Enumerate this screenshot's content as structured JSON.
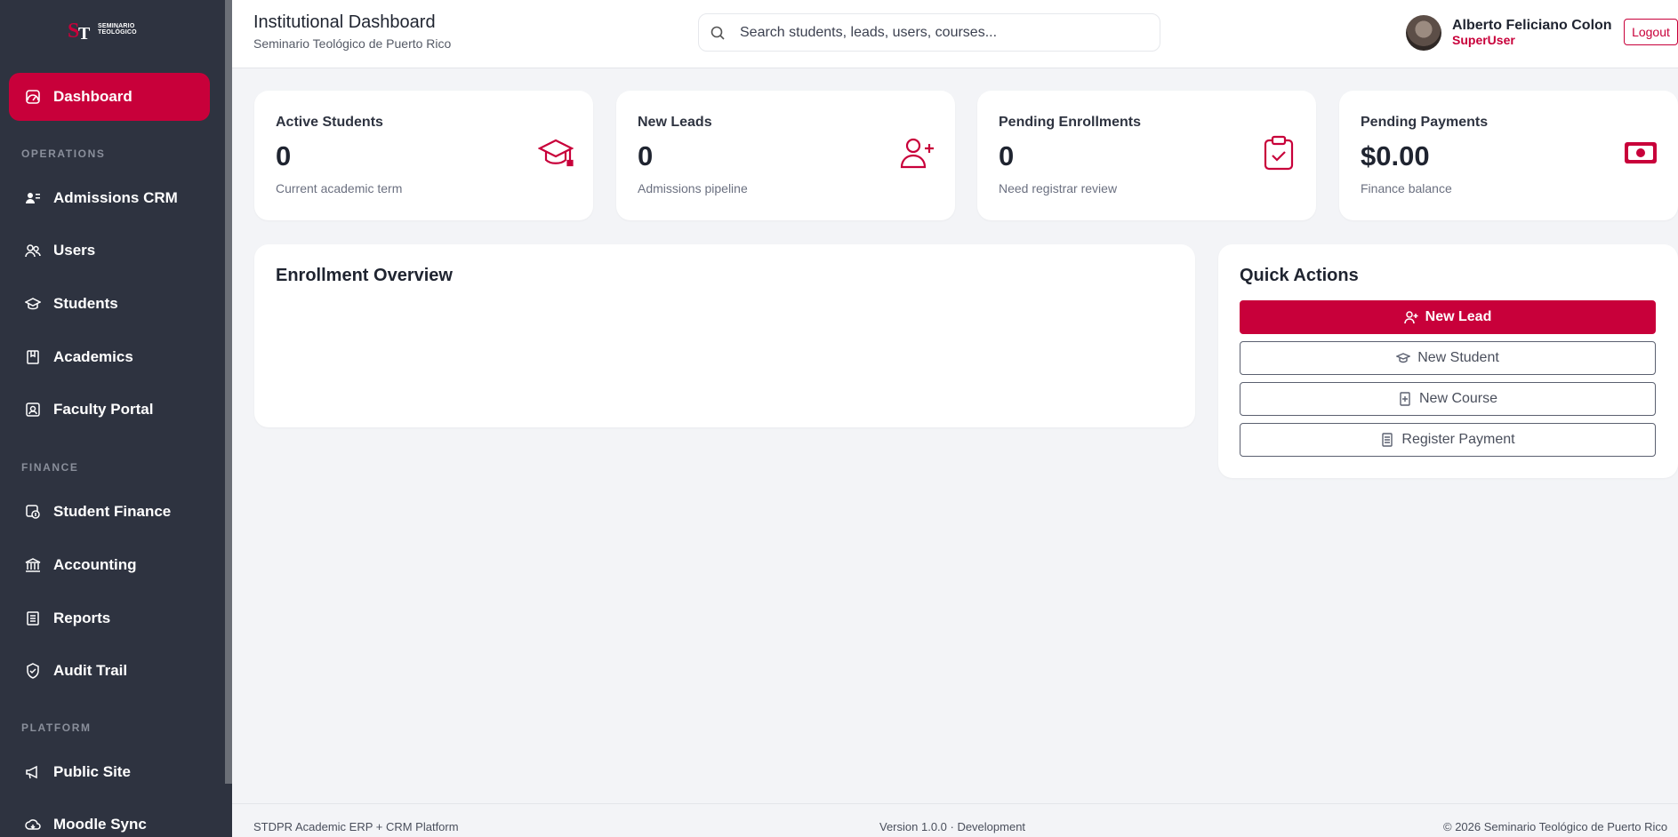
{
  "brand": {
    "logo_text_line1": "SEMINARIO",
    "logo_text_line2": "TEOLÓGICO",
    "accent_color": "#c8003a",
    "sidebar_color": "#2e3340"
  },
  "sidebar": {
    "items": [
      {
        "label": "Dashboard",
        "icon": "gauge-icon",
        "active": true
      },
      {
        "label": "Admissions CRM",
        "icon": "user-list-icon"
      },
      {
        "label": "Users",
        "icon": "users-icon"
      },
      {
        "label": "Students",
        "icon": "graduation-cap-icon"
      },
      {
        "label": "Academics",
        "icon": "book-icon"
      },
      {
        "label": "Faculty Portal",
        "icon": "id-badge-icon"
      },
      {
        "label": "Student Finance",
        "icon": "finance-icon"
      },
      {
        "label": "Accounting",
        "icon": "bank-icon"
      },
      {
        "label": "Reports",
        "icon": "report-icon"
      },
      {
        "label": "Audit Trail",
        "icon": "shield-check-icon"
      },
      {
        "label": "Public Site",
        "icon": "megaphone-icon"
      },
      {
        "label": "Moodle Sync",
        "icon": "cloud-sync-icon"
      }
    ],
    "sections": {
      "operations": "OPERATIONS",
      "finance": "FINANCE",
      "platform": "PLATFORM"
    }
  },
  "header": {
    "title": "Institutional Dashboard",
    "subtitle": "Seminario Teológico de Puerto Rico",
    "search_placeholder": "Search students, leads, users, courses...",
    "user_name": "Alberto Feliciano Colon",
    "user_role": "SuperUser",
    "logout_label": "Logout"
  },
  "stats": [
    {
      "label": "Active Students",
      "value": "0",
      "desc": "Current academic term",
      "icon": "graduation-cap-icon"
    },
    {
      "label": "New Leads",
      "value": "0",
      "desc": "Admissions pipeline",
      "icon": "user-plus-icon"
    },
    {
      "label": "Pending Enrollments",
      "value": "0",
      "desc": "Need registrar review",
      "icon": "clipboard-check-icon"
    },
    {
      "label": "Pending Payments",
      "value": "$0.00",
      "desc": "Finance balance",
      "icon": "cash-icon"
    }
  ],
  "overview": {
    "title": "Enrollment Overview"
  },
  "quick_actions": {
    "title": "Quick Actions",
    "buttons": [
      {
        "label": "New Lead",
        "icon": "user-plus-icon"
      },
      {
        "label": "New Student",
        "icon": "graduation-cap-icon"
      },
      {
        "label": "New Course",
        "icon": "book-plus-icon"
      },
      {
        "label": "Register Payment",
        "icon": "receipt-icon"
      }
    ]
  },
  "footer": {
    "left": "STDPR Academic ERP + CRM Platform",
    "center": "Version 1.0.0 · Development",
    "right": "© 2026 Seminario Teológico de Puerto Rico"
  }
}
